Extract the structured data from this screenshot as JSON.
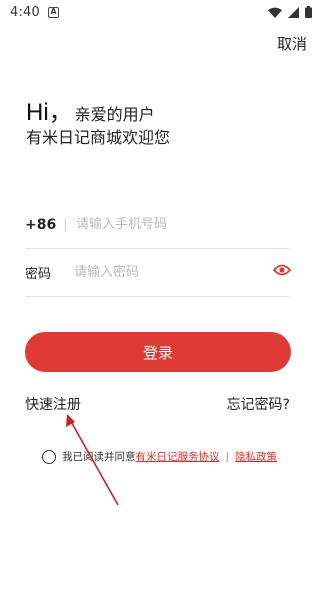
{
  "status_bar": {
    "time": "4:40",
    "app_icon_letter": "A"
  },
  "header": {
    "cancel_label": "取消"
  },
  "greeting": {
    "hi": "Hi，",
    "line1_rest": "亲爱的用户",
    "line2": "有米日记商城欢迎您"
  },
  "phone_row": {
    "prefix": "+86",
    "placeholder": "请输入手机号码"
  },
  "password_row": {
    "label": "密码",
    "placeholder": "请输入密码"
  },
  "login_button": {
    "label": "登录"
  },
  "links": {
    "register": "快速注册",
    "forgot": "忘记密码?"
  },
  "agreement": {
    "prefix": "我已阅读并同意",
    "service_link": "有米日记服务协议",
    "divider": "|",
    "privacy_link": "隐私政策"
  },
  "colors": {
    "accent": "#e03a36",
    "link": "#d9302c",
    "annotation": "#cc2020"
  }
}
